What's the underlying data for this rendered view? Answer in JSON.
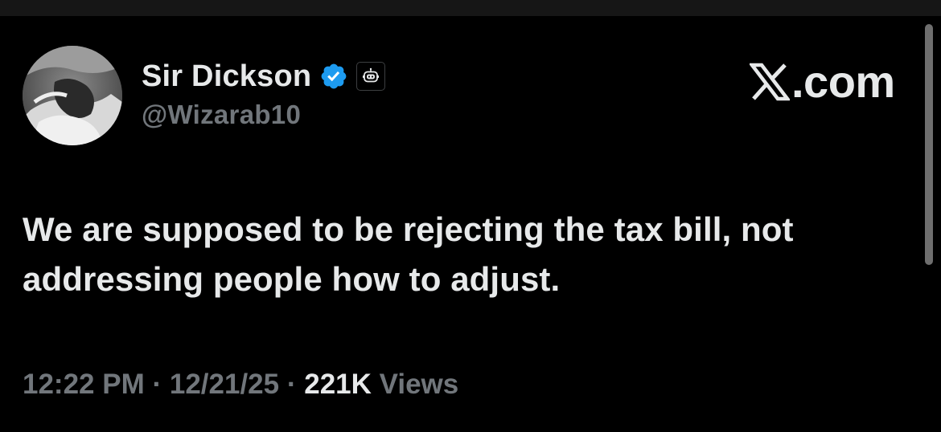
{
  "author": {
    "display_name": "Sir Dickson",
    "handle": "@Wizarab10",
    "verified": true,
    "verified_color": "#1d9bf0",
    "avatar_icon": "grayscale-profile-photo",
    "automated_badge_icon": "robot-icon"
  },
  "brand": {
    "label": ".com",
    "logo_icon": "x-logo-icon"
  },
  "tweet": {
    "text": "We are supposed to be rejecting the tax bill, not addressing people how to adjust."
  },
  "meta": {
    "time": "12:22 PM",
    "separator": "·",
    "date": "12/21/25",
    "views_count": "221K",
    "views_label": "Views"
  },
  "colors": {
    "background": "#000000",
    "primary_text": "#e7e9ea",
    "secondary_text": "#71767b",
    "accent": "#1d9bf0"
  }
}
